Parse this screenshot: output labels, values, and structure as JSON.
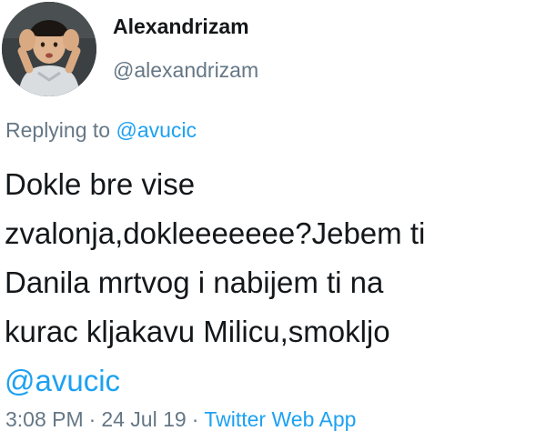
{
  "author": {
    "display_name": "Alexandrizam",
    "handle": "@alexandrizam",
    "avatar_icon": "child-photo-avatar"
  },
  "reply": {
    "prefix": "Replying to",
    "mention": "@avucic"
  },
  "tweet": {
    "lines": [
      "Dokle bre vise",
      "zvalonja,dokleeeeeee?Jebem ti",
      "Danila mrtvog i nabijem ti na",
      "kurac kljakavu Milicu,smokljo"
    ],
    "mention": "@avucic"
  },
  "meta": {
    "time": "3:08 PM",
    "separator": "·",
    "date": "24 Jul 19",
    "source": "Twitter Web App"
  },
  "colors": {
    "link": "#1da1f2",
    "secondary_text": "#657786",
    "primary_text": "#14171a"
  }
}
